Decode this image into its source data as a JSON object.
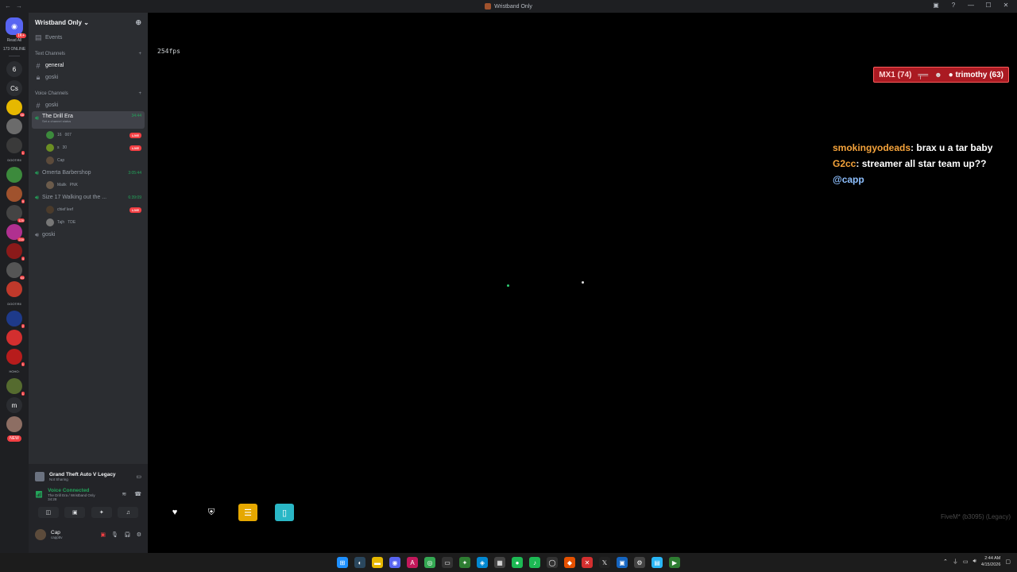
{
  "window": {
    "title": "Wristband Only",
    "nav_back": "←",
    "nav_forward": "→",
    "inbox_icon": "▣",
    "help_icon": "?",
    "minimize": "—",
    "maximize": "☐",
    "close": "✕"
  },
  "rail": {
    "logo_badge": "1K+",
    "read_all": "Read All",
    "online": "173 ONLINE",
    "dm_six": "6",
    "cs": "Cs",
    "folder1": "DOOT:RII",
    "folder2": "DOOT:RII",
    "folder3": "HOHO:",
    "m": "m",
    "new": "NEW",
    "badges": [
      "58",
      "1",
      "9",
      "1",
      "126",
      "239",
      "4",
      "44",
      "2",
      "1",
      "1",
      "1",
      "3"
    ]
  },
  "server": {
    "name": "Wristband Only",
    "chevron": "⌄",
    "invite_icon": "⊕",
    "events": "Events",
    "text_category": "Text Channels",
    "voice_category": "Voice Channels",
    "text_channels": [
      "general",
      "goski"
    ],
    "voice_text_channel": "goski",
    "voice_channels": [
      {
        "name": "The Drill Era",
        "status": "Set a channel status",
        "time": "34:44",
        "users": [
          {
            "name": "16",
            "tag": "007",
            "live": "LIVE"
          },
          {
            "name": "s",
            "tag": "30",
            "live": "LIVE"
          },
          {
            "name": "Cap",
            "tag": "",
            "live": ""
          }
        ]
      },
      {
        "name": "Omerta Barbershop",
        "time": "3:05:44",
        "users": [
          {
            "name": "Malik",
            "tag": "PNK",
            "live": ""
          }
        ]
      },
      {
        "name": "Size 17 Walking out the ...",
        "time": "6:39:09",
        "users": [
          {
            "name": "chief leef",
            "tag": "",
            "live": "LIVE"
          },
          {
            "name": "Tajh",
            "tag": "TDE",
            "live": ""
          }
        ]
      },
      {
        "name": "goski",
        "time": "",
        "users": []
      }
    ]
  },
  "panel": {
    "activity_title": "Grand Theft Auto V Legacy",
    "activity_sub": "Not Sharing",
    "voice_title": "Voice Connected",
    "voice_sub": "The Drill Era / Wristband Only",
    "voice_time": "34:28",
    "username": "Cap",
    "user_handle": "cappttv"
  },
  "game": {
    "fps": "254fps",
    "killer": "MX1 (74)",
    "victim": "trimothy (63)",
    "chat": [
      {
        "name": "smokingyodeads",
        "msg": ": brax u a tar baby"
      },
      {
        "name": "G2cc",
        "msg": ": streamer all star team up??"
      }
    ],
    "mention": "@capp",
    "watermark": "FiveM* (b3095) (Legacy)"
  },
  "taskbar": {
    "time": "2:44 AM",
    "date": "4/15/2026"
  },
  "colors": {
    "accent": "#5865f2",
    "voice_green": "#23a55a",
    "live_red": "#f23f43",
    "chat_name": "#f5a33b"
  }
}
